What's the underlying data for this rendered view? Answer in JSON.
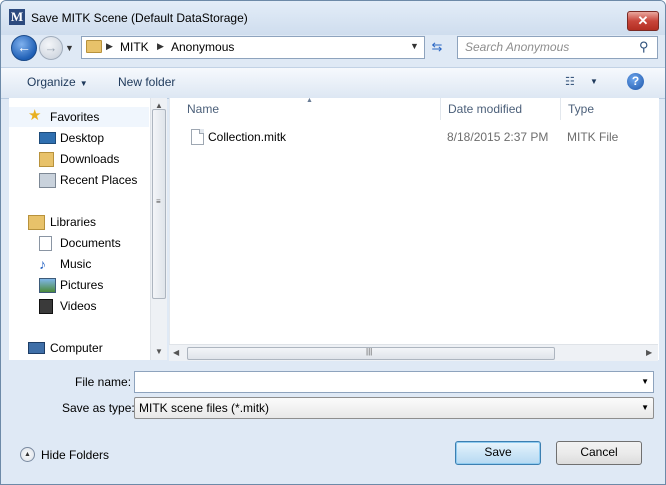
{
  "window": {
    "title": "Save MITK Scene (Default DataStorage)",
    "close_glyph": "✕",
    "app_icon_letter": "M"
  },
  "nav": {
    "breadcrumbs": [
      "MITK",
      "Anonymous"
    ],
    "search_placeholder": "Search Anonymous"
  },
  "toolbar": {
    "organize": "Organize",
    "new_folder": "New folder"
  },
  "sidebar": {
    "favorites": "Favorites",
    "favorite_items": [
      "Desktop",
      "Downloads",
      "Recent Places"
    ],
    "libraries": "Libraries",
    "library_items": [
      "Documents",
      "Music",
      "Pictures",
      "Videos"
    ],
    "computer": "Computer"
  },
  "columns": {
    "name": "Name",
    "date": "Date modified",
    "type": "Type"
  },
  "files": [
    {
      "name": "Collection.mitk",
      "date": "8/18/2015 2:37 PM",
      "type": "MITK File"
    }
  ],
  "form": {
    "file_name_label": "File name:",
    "file_name_value": "",
    "save_type_label": "Save as type:",
    "save_type_value": "MITK scene files (*.mitk)"
  },
  "footer": {
    "hide_folders": "Hide Folders",
    "save": "Save",
    "cancel": "Cancel"
  }
}
